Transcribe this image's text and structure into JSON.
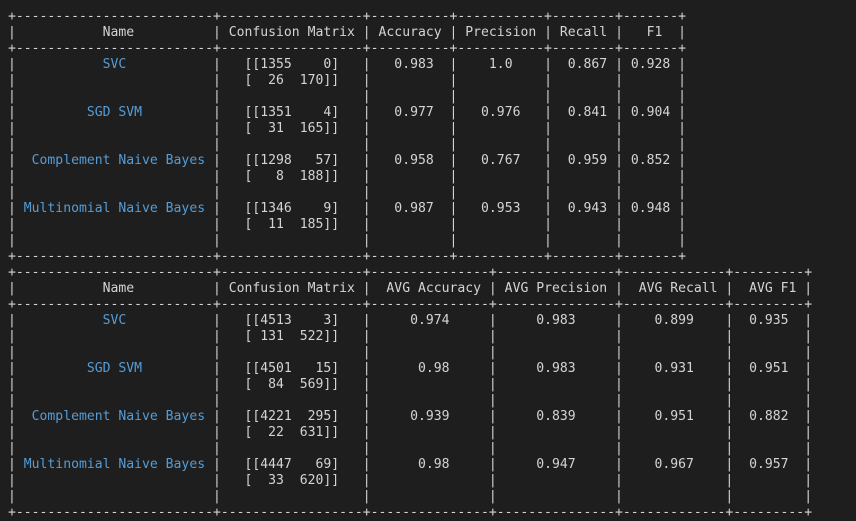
{
  "colors": {
    "background": "#1e1e1e",
    "text": "#d4d4d4",
    "model_name": "#569cd6"
  },
  "tables": [
    {
      "columns": [
        "Name",
        "Confusion Matrix",
        "Accuracy",
        "Precision",
        "Recall",
        "F1"
      ],
      "rows": [
        {
          "name": "SVC",
          "cm1": "[[1355    0]",
          "cm2": "[  26  170]]",
          "m": [
            "0.983",
            "1.0",
            "0.867",
            "0.928"
          ]
        },
        {
          "name": "SGD SVM",
          "cm1": "[[1351    4]",
          "cm2": "[  31  165]]",
          "m": [
            "0.977",
            "0.976",
            "0.841",
            "0.904"
          ]
        },
        {
          "name": "Complement Naive Bayes",
          "cm1": "[[1298   57]",
          "cm2": "[   8  188]]",
          "m": [
            "0.958",
            "0.767",
            "0.959",
            "0.852"
          ]
        },
        {
          "name": "Multinomial Naive Bayes",
          "cm1": "[[1346    9]",
          "cm2": "[  11  185]]",
          "m": [
            "0.987",
            "0.953",
            "0.943",
            "0.948"
          ]
        }
      ]
    },
    {
      "columns": [
        "Name",
        "Confusion Matrix",
        "AVG Accuracy",
        "AVG Precision",
        "AVG Recall",
        "AVG F1"
      ],
      "rows": [
        {
          "name": "SVC",
          "cm1": "[[4513    3]",
          "cm2": "[ 131  522]]",
          "m": [
            "0.974",
            "0.983",
            "0.899",
            "0.935"
          ]
        },
        {
          "name": "SGD SVM",
          "cm1": "[[4501   15]",
          "cm2": "[  84  569]]",
          "m": [
            "0.98",
            "0.983",
            "0.931",
            "0.951"
          ]
        },
        {
          "name": "Complement Naive Bayes",
          "cm1": "[[4221  295]",
          "cm2": "[  22  631]]",
          "m": [
            "0.939",
            "0.839",
            "0.951",
            "0.882"
          ]
        },
        {
          "name": "Multinomial Naive Bayes",
          "cm1": "[[4447   69]",
          "cm2": "[  33  620]]",
          "m": [
            "0.98",
            "0.947",
            "0.967",
            "0.957"
          ]
        }
      ]
    }
  ]
}
